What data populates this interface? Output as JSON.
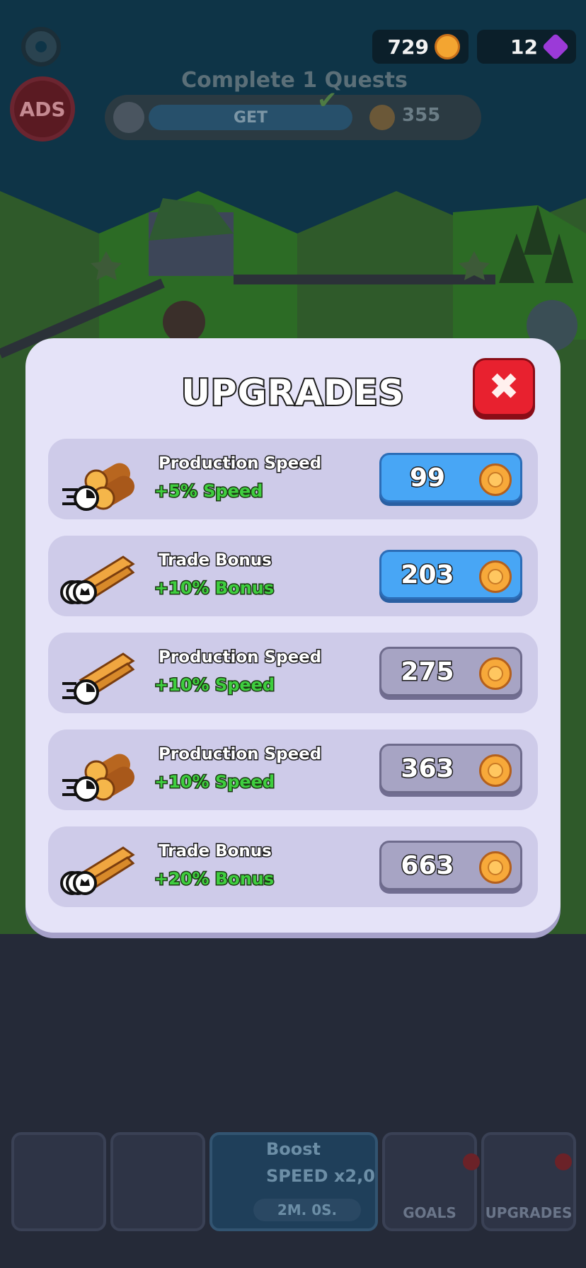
{
  "hud": {
    "coins": "729",
    "gems": "12",
    "ads_label": "ADS",
    "quest_title": "Complete 1 Quests",
    "quest_button": "GET",
    "quest_reward": "355"
  },
  "bottom_nav": {
    "boost_title": "Boost",
    "boost_sub": "SPEED x2,0",
    "boost_time": "2M. 0S.",
    "goals_label": "GOALS",
    "upgrades_label": "UPGRADES"
  },
  "dialog": {
    "title": "UPGRADES",
    "close_icon": "close-icon",
    "rows": [
      {
        "name": "Production Speed",
        "bonus": "+5% Speed",
        "price": "99",
        "icon": "logs-speed-icon",
        "state": "active"
      },
      {
        "name": "Trade Bonus",
        "bonus": "+10% Bonus",
        "price": "203",
        "icon": "planks-coins-icon",
        "state": "active"
      },
      {
        "name": "Production Speed",
        "bonus": "+10% Speed",
        "price": "275",
        "icon": "planks-speed-icon",
        "state": "inactive"
      },
      {
        "name": "Production Speed",
        "bonus": "+10% Speed",
        "price": "363",
        "icon": "logs-speed-icon",
        "state": "inactive"
      },
      {
        "name": "Trade Bonus",
        "bonus": "+20% Bonus",
        "price": "663",
        "icon": "planks-coins-icon",
        "state": "inactive"
      }
    ]
  },
  "colors": {
    "active_button": "#48a6f5",
    "inactive_button": "#a7a4c4",
    "bonus_text": "#3fce3f",
    "close_button": "#e8212f",
    "dialog_bg": "#e5e3f8"
  }
}
